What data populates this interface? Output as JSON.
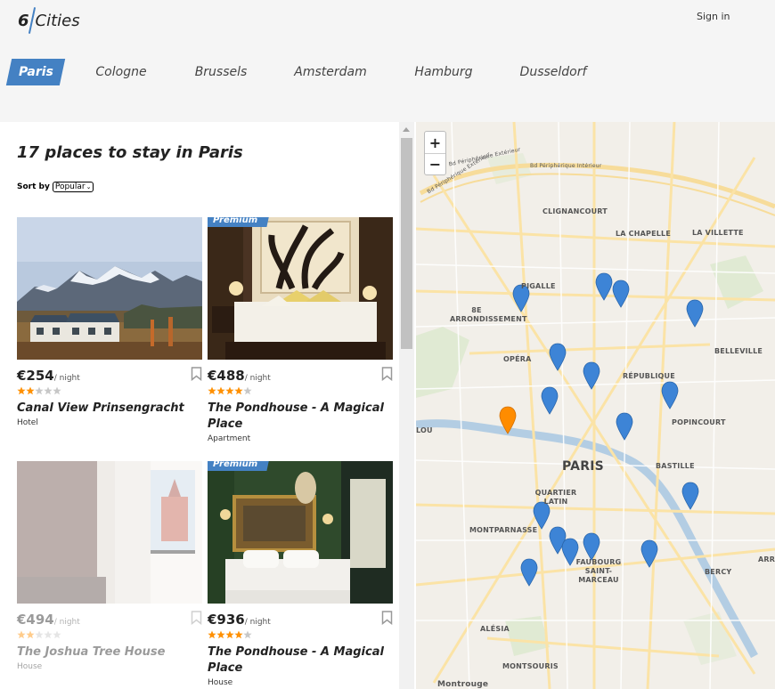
{
  "header": {
    "logo_number": "6",
    "logo_text": "Cities",
    "signin_label": "Sign in"
  },
  "cities": [
    "Paris",
    "Cologne",
    "Brussels",
    "Amsterdam",
    "Hamburg",
    "Dusseldorf"
  ],
  "active_city": "Paris",
  "list": {
    "title": "17 places to stay in Paris",
    "sort_label": "Sort by",
    "sort_value": "Popular"
  },
  "cards": [
    {
      "premium": false,
      "price": "€254",
      "per": "/ night",
      "rating": 2,
      "name": "Canal View Prinsengracht",
      "type": "Hotel",
      "image": "mountain-house-photo",
      "faded": false
    },
    {
      "premium": true,
      "premium_label": "Premium",
      "price": "€488",
      "per": "/ night",
      "rating": 4,
      "name": "The Pondhouse - A Magical Place",
      "type": "Apartment",
      "image": "hotel-bedroom-photo",
      "faded": false
    },
    {
      "premium": false,
      "price": "€494",
      "per": "/ night",
      "rating": 2,
      "name": "The Joshua Tree House",
      "type": "House",
      "image": "window-view-photo",
      "faded": true
    },
    {
      "premium": true,
      "premium_label": "Premium",
      "price": "€936",
      "per": "/ night",
      "rating": 4,
      "name": "The Pondhouse - A Magical Place",
      "type": "House",
      "image": "green-bedroom-photo",
      "faded": false
    }
  ],
  "map": {
    "zoom_in": "+",
    "zoom_out": "−",
    "labels": [
      "Bd Périphérique Extérieur",
      "Bd Périphérique Intérieur",
      "Bd Périphérique Extérieur",
      "CLIGNANCOURT",
      "LA CHAPELLE",
      "LA VILLETTE",
      "PIGALLE",
      "8E ARRONDISSEMENT",
      "OPÉRA",
      "RÉPUBLIQUE",
      "BELLEVILLE",
      "POPINCOURT",
      "PARIS",
      "BASTILLE",
      "QUARTIER LATIN",
      "MONTPARNASSE",
      "FAUBOURG SAINT-MARCEAU",
      "BERCY",
      "ALÉSIA",
      "MONTSOURIS",
      "Montrouge",
      "LOU",
      "ARRO"
    ],
    "active_marker_color": "#ff8c00",
    "marker_color": "#3d84d6"
  },
  "colors": {
    "accent": "#4481c3",
    "star": "#ff9000"
  }
}
